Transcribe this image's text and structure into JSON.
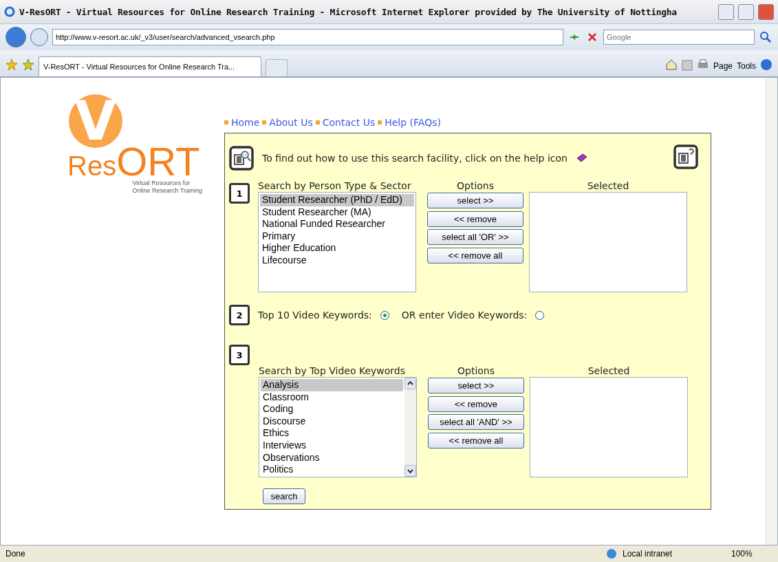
{
  "window": {
    "title": "V-ResORT - Virtual Resources for Online Research Training - Microsoft Internet Explorer provided by The University of Nottingha"
  },
  "address": {
    "url": "http://www.v-resort.ac.uk/_v3/user/search/advanced_vsearch.php"
  },
  "search": {
    "placeholder": "Google"
  },
  "tabs": [
    {
      "label": "V-ResORT - Virtual Resources for Online Research Tra...",
      "selected": true
    }
  ],
  "toolbar": [
    "Page",
    "Tools"
  ],
  "logo": {
    "mark": "V",
    "prefix": "Res",
    "suffix": "ORT",
    "tagline_1": "Virtual Resources for",
    "tagline_2": "Online Research Training"
  },
  "nav": [
    "Home",
    "About Us",
    "Contact Us",
    "Help (FAQs)"
  ],
  "help_text": "To find out how to use this search facility, click on the help icon",
  "step_1": {
    "number": "1",
    "heading": "Search by Person Type & Sector",
    "options_heading": "Options",
    "selected_heading": "Selected",
    "scrollbar": false,
    "items": [
      {
        "label": "Student Researcher (PhD / EdD)",
        "selected": true
      },
      {
        "label": "Student Researcher (MA)",
        "selected": false
      },
      {
        "label": "National Funded Researcher",
        "selected": false
      },
      {
        "label": "Primary",
        "selected": false
      },
      {
        "label": "Higher Education",
        "selected": false
      },
      {
        "label": "Lifecourse",
        "selected": false
      }
    ],
    "buttons": [
      "select >>",
      "<< remove",
      "select all 'OR' >>",
      "<< remove all"
    ]
  },
  "step_2": {
    "number": "2",
    "radios": [
      {
        "label": "Top 10 Video Keywords:",
        "selected": true
      },
      {
        "label": "OR enter Video Keywords:",
        "selected": false
      }
    ]
  },
  "step_3": {
    "number": "3",
    "heading": "Search by Top Video Keywords",
    "options_heading": "Options",
    "selected_heading": "Selected",
    "scrollbar": true,
    "items": [
      {
        "label": "Analysis",
        "selected": true
      },
      {
        "label": "Classroom",
        "selected": false
      },
      {
        "label": "Coding",
        "selected": false
      },
      {
        "label": "Discourse",
        "selected": false
      },
      {
        "label": "Ethics",
        "selected": false
      },
      {
        "label": "Interviews",
        "selected": false
      },
      {
        "label": "Observations",
        "selected": false
      },
      {
        "label": "Politics",
        "selected": false
      }
    ],
    "buttons": [
      "select >>",
      "<< remove",
      "select all 'AND' >>",
      "<< remove all"
    ]
  },
  "search_button": "search",
  "status_bar": {
    "text": "Done",
    "zone": "Local intranet",
    "zoom": "100%"
  }
}
